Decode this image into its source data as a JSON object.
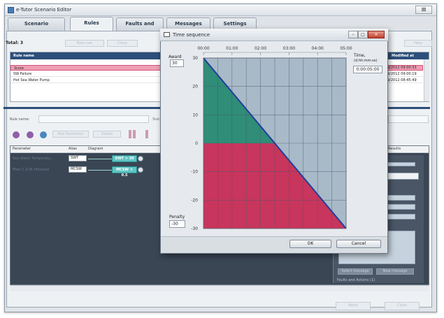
{
  "window": {
    "title": "e-Tutor Scenario Editor",
    "close_glyph": "⊠"
  },
  "tabs": [
    "Scenario description",
    "Rules",
    "Faults and Actions",
    "Messages",
    "Settings"
  ],
  "rules": {
    "total_label": "Total: 3",
    "new_rule": "New rule",
    "clone": "Clone",
    "help": "Help",
    "columns": {
      "name": "Rule name",
      "modified": "Modified at"
    },
    "rows": [
      {
        "name": "Score",
        "modified": "9/2012 09:00:33"
      },
      {
        "name": "SW Failure",
        "modified": "9/2012 09:00:19"
      },
      {
        "name": "Hot Sea Water Pump",
        "modified": "9/2012 08:45:49"
      }
    ]
  },
  "editor": {
    "rule_name_label": "Rule name:",
    "status_label": "Stat",
    "add_parameter": "Add Parameter",
    "delete": "Delete",
    "columns": {
      "parameter": "Parameter",
      "alias": "Alias",
      "diagram": "Diagram",
      "results": "Results"
    },
    "params": [
      {
        "name": "Sea Water Temperatu...",
        "alias": "SWT",
        "condition": "SWT > 30"
      },
      {
        "name": "Main C.S.W. Pressure",
        "alias": "MCSW",
        "condition": "MCSW < 0.5"
      }
    ],
    "select_message": "Select message",
    "new_message": "New message",
    "faults_actions": "Faults and Actions (1)",
    "apply": "Apply",
    "close": "Close"
  },
  "dialog": {
    "title": "Time sequence",
    "award_label": "Award",
    "award_value": "30",
    "penalty_label": "Penalty",
    "penalty_value": "-30",
    "time_label": "Time,",
    "time_unit": "(d.hh:mm:ss)",
    "time_value": "0:00:05:00",
    "ok": "OK",
    "cancel": "Cancel"
  },
  "chart_data": {
    "type": "area",
    "x_ticks": [
      "00:00",
      "01:00",
      "02:00",
      "03:00",
      "04:00",
      "05:00"
    ],
    "x_minutes": [
      0,
      1,
      2,
      3,
      4,
      5
    ],
    "y_ticks": [
      30,
      20,
      10,
      0,
      -10,
      -20,
      -30
    ],
    "ylim": [
      -30,
      30
    ],
    "xlim": [
      0,
      5
    ],
    "series": [
      {
        "x": [
          0,
          5
        ],
        "y": [
          30,
          -30
        ]
      }
    ],
    "positive_color": "#2f8d78",
    "negative_color": "#c8355d",
    "background_color": "#a8b9c8",
    "grid": true
  }
}
